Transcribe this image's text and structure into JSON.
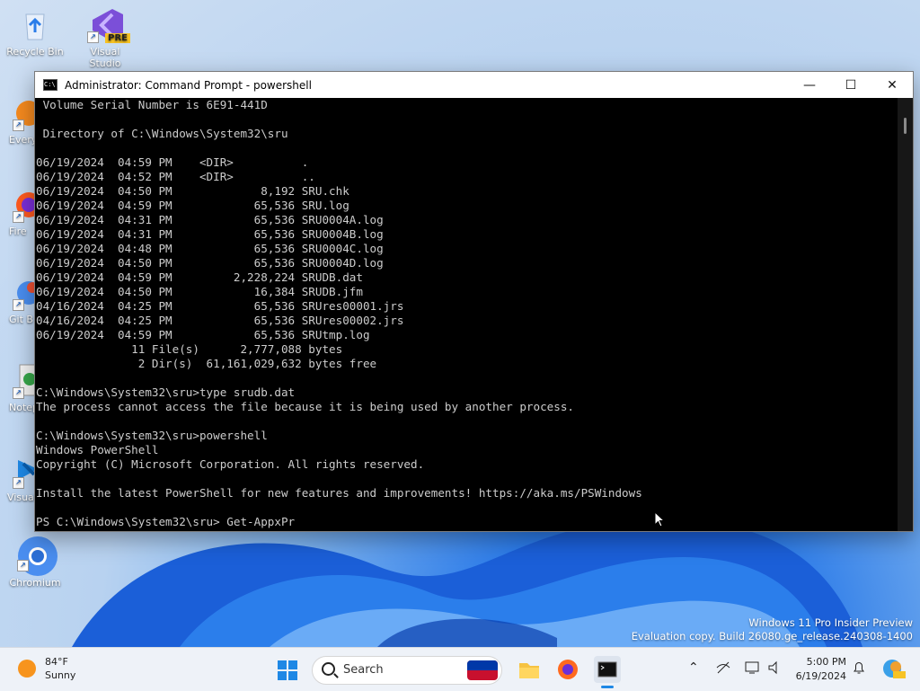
{
  "desktop": {
    "icons": [
      {
        "label": "Recycle Bin"
      },
      {
        "label": "Visual Studio",
        "badge": "PRE"
      },
      {
        "label": "Every"
      },
      {
        "label": "Fire"
      },
      {
        "label": "Git B"
      },
      {
        "label": "Notep"
      },
      {
        "label": "Visual"
      },
      {
        "label": "Chromium"
      }
    ],
    "watermark": {
      "line1": "Windows 11 Pro Insider Preview",
      "line2": "Evaluation copy. Build 26080.ge_release.240308-1400"
    }
  },
  "window": {
    "title": "Administrator: Command Prompt - powershell",
    "controls": {
      "minimize": "—",
      "maximize": "☐",
      "close": "✕"
    }
  },
  "console": {
    "lines": [
      " Volume Serial Number is 6E91-441D",
      "",
      " Directory of C:\\Windows\\System32\\sru",
      "",
      "06/19/2024  04:59 PM    <DIR>          .",
      "06/19/2024  04:52 PM    <DIR>          ..",
      "06/19/2024  04:50 PM             8,192 SRU.chk",
      "06/19/2024  04:59 PM            65,536 SRU.log",
      "06/19/2024  04:31 PM            65,536 SRU0004A.log",
      "06/19/2024  04:31 PM            65,536 SRU0004B.log",
      "06/19/2024  04:48 PM            65,536 SRU0004C.log",
      "06/19/2024  04:50 PM            65,536 SRU0004D.log",
      "06/19/2024  04:59 PM         2,228,224 SRUDB.dat",
      "06/19/2024  04:50 PM            16,384 SRUDB.jfm",
      "04/16/2024  04:25 PM            65,536 SRUres00001.jrs",
      "04/16/2024  04:25 PM            65,536 SRUres00002.jrs",
      "06/19/2024  04:59 PM            65,536 SRUtmp.log",
      "              11 File(s)      2,777,088 bytes",
      "               2 Dir(s)  61,161,029,632 bytes free",
      "",
      "C:\\Windows\\System32\\sru>type srudb.dat",
      "The process cannot access the file because it is being used by another process.",
      "",
      "C:\\Windows\\System32\\sru>powershell",
      "Windows PowerShell",
      "Copyright (C) Microsoft Corporation. All rights reserved.",
      "",
      "Install the latest PowerShell for new features and improvements! https://aka.ms/PSWindows",
      "",
      "PS C:\\Windows\\System32\\sru> Get-AppxPr"
    ]
  },
  "taskbar": {
    "weather": {
      "temp": "84°F",
      "condition": "Sunny"
    },
    "search_placeholder": "Search",
    "clock": {
      "time": "5:00 PM",
      "date": "6/19/2024"
    },
    "accent_color": "#1e88e5"
  }
}
